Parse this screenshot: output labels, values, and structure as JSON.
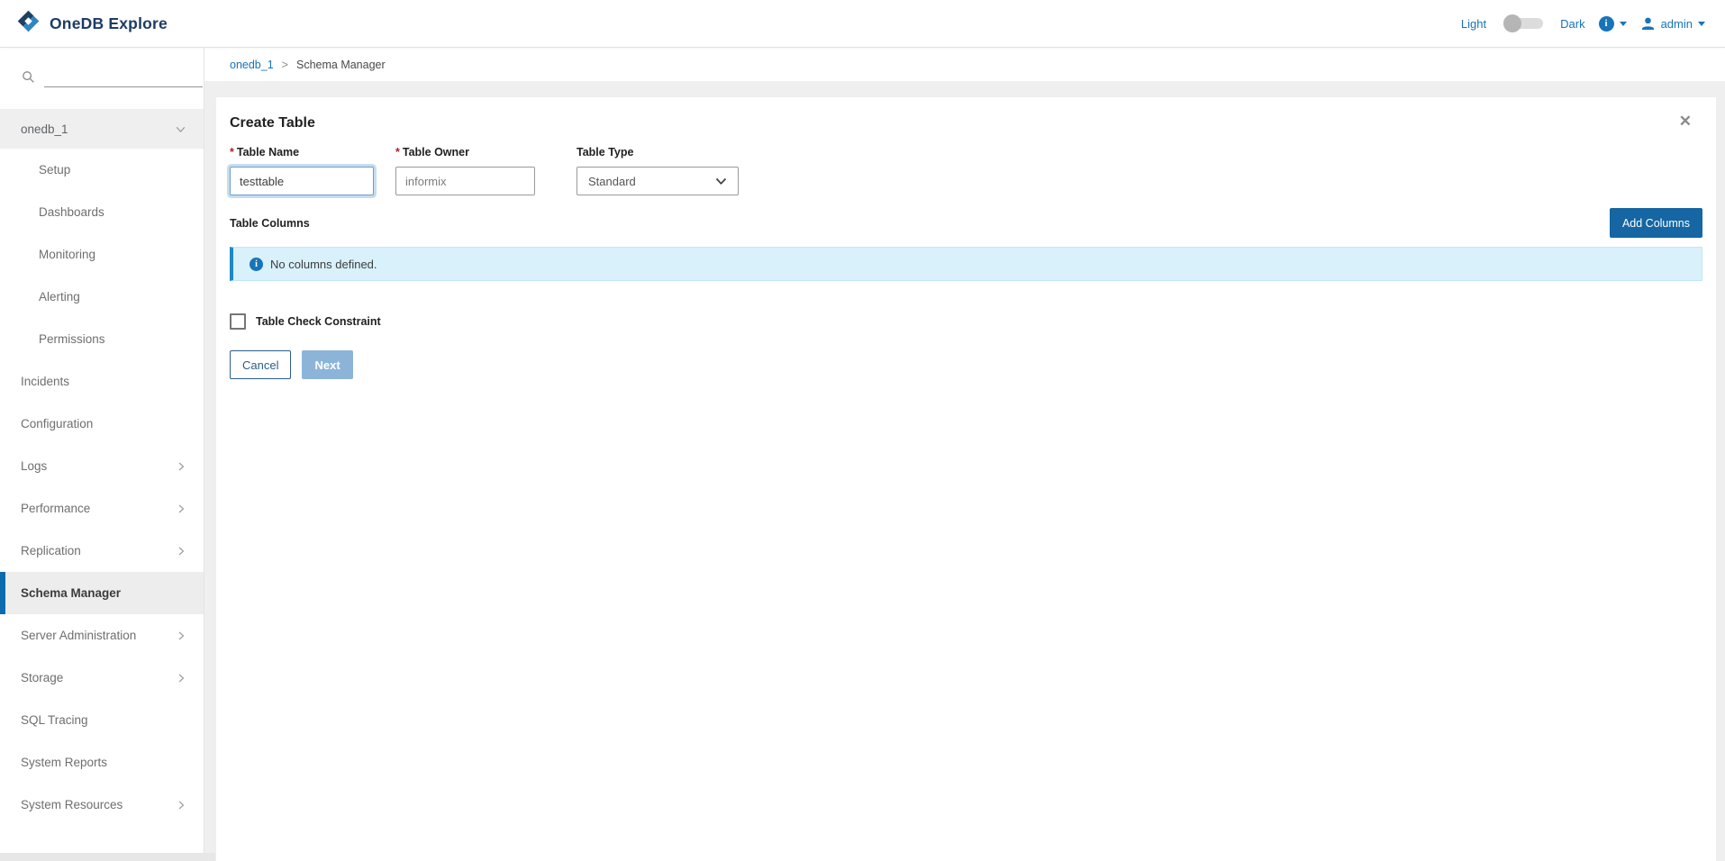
{
  "header": {
    "logo_text": "OneDB Explore",
    "theme_toggle": {
      "light_label": "Light",
      "dark_label": "Dark",
      "state": "light"
    },
    "user": {
      "label": "admin"
    }
  },
  "icons": {
    "info_glyph": "i",
    "close_glyph": "✕",
    "required_marker": "*",
    "breadcrumb_separator": ">"
  },
  "sidebar": {
    "search": {
      "placeholder": ""
    },
    "database": {
      "label": "onedb_1",
      "expanded": true
    },
    "sub_items": [
      "Setup",
      "Dashboards",
      "Monitoring",
      "Alerting",
      "Permissions"
    ],
    "items": [
      {
        "label": "Incidents"
      },
      {
        "label": "Configuration"
      },
      {
        "label": "Logs",
        "expandable": true
      },
      {
        "label": "Performance",
        "expandable": true
      },
      {
        "label": "Replication",
        "expandable": true
      },
      {
        "label": "Schema Manager",
        "active": true
      },
      {
        "label": "Server Administration",
        "expandable": true
      },
      {
        "label": "Storage",
        "expandable": true
      },
      {
        "label": "SQL Tracing"
      },
      {
        "label": "System Reports"
      },
      {
        "label": "System Resources",
        "expandable": true
      }
    ]
  },
  "breadcrumb": {
    "database": "onedb_1",
    "page": "Schema Manager"
  },
  "dialog": {
    "title": "Create Table",
    "fields": {
      "table_name": {
        "label": "Table Name",
        "value": "testtable",
        "required": true
      },
      "table_owner": {
        "label": "Table Owner",
        "value": "informix",
        "required": true
      },
      "table_type": {
        "label": "Table Type",
        "value": "Standard"
      }
    },
    "columns": {
      "section_label": "Table Columns",
      "add_button_label": "Add Columns",
      "empty_message": "No columns defined."
    },
    "check_constraint": {
      "label": "Table Check Constraint",
      "checked": false
    },
    "actions": {
      "cancel_label": "Cancel",
      "next_label": "Next",
      "next_enabled": false
    }
  },
  "colors": {
    "accent": "#1774b8",
    "primary_button": "#1566a3",
    "disabled_button": "#8cb4d9",
    "alert_bg": "#d8f1fb",
    "alert_border": "#1c89c8",
    "active_nav_border": "#0d6cad",
    "required": "#ab2328"
  }
}
